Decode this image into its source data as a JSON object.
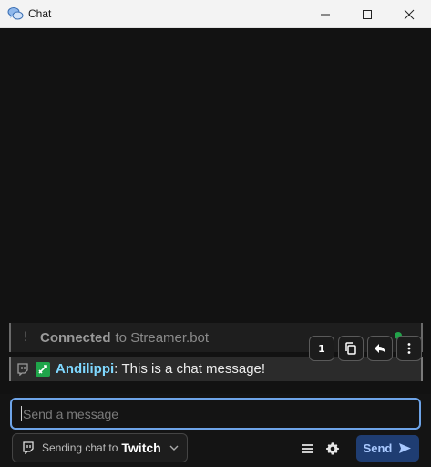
{
  "window": {
    "title": "Chat"
  },
  "messages": {
    "connected": {
      "bold": "Connected",
      "rest": "to Streamer.bot"
    },
    "chat": {
      "author": "Andilippi",
      "separator": ": ",
      "text": "This is a chat message!"
    }
  },
  "actions": {
    "count_label": "1"
  },
  "composer": {
    "placeholder": "Send a message",
    "platform_prefix": "Sending chat to",
    "platform": "Twitch",
    "send_label": "Send"
  },
  "colors": {
    "author": "#7fd8ff",
    "accent_border": "#6ea4e8",
    "send_bg": "#1f3d72",
    "badge": "#1fa54a"
  },
  "icons": {
    "app": "chat-bubbles-icon",
    "minimize": "minimize-icon",
    "maximize": "maximize-icon",
    "close": "close-icon",
    "system": "exclamation-icon",
    "platform": "twitch-icon",
    "badge": "sword-badge-icon",
    "copy": "copy-icon",
    "reply": "reply-icon",
    "more": "more-vertical-icon",
    "dropdown": "chevron-down-icon",
    "menu": "hamburger-menu-icon",
    "settings": "gear-icon",
    "send": "send-arrow-icon"
  }
}
